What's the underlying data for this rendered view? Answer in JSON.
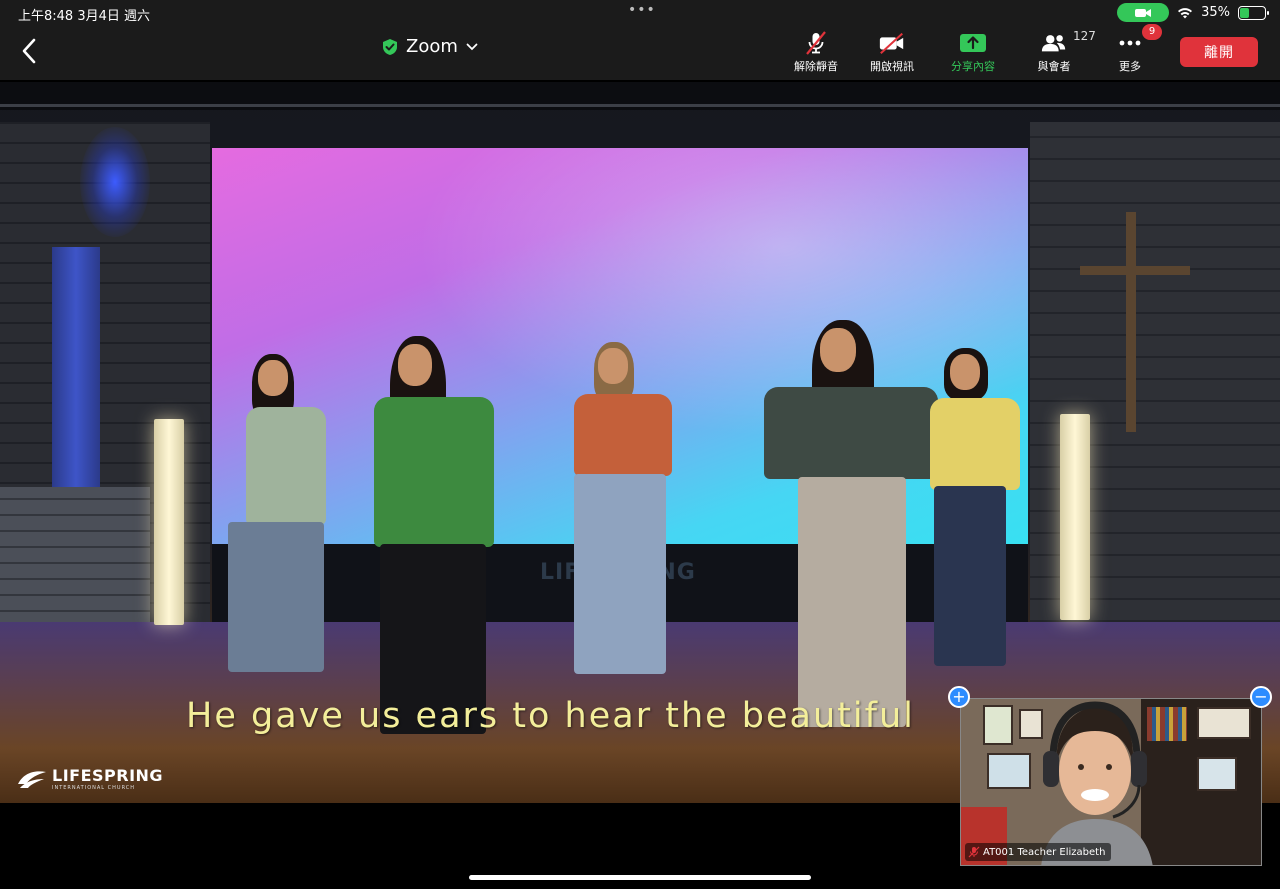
{
  "status_bar": {
    "time_date": "上午8:48   3月4日 週六",
    "dots": "•••",
    "battery_percent": "35%",
    "battery_level": 0.35,
    "colors": {
      "camera_pill": "#34c759",
      "battery_fill": "#34c759"
    }
  },
  "toolbar": {
    "meeting_title": "Zoom",
    "buttons": {
      "unmute": "解除靜音",
      "start_video": "開啟視訊",
      "share": "分享內容",
      "participants": "與會者",
      "more": "更多"
    },
    "participant_count": "127",
    "more_badge": "9",
    "leave_label": "離開",
    "colors": {
      "share_green": "#34c759",
      "leave_red": "#e0333b",
      "badge_red": "#e0333b",
      "shield_green": "#34c759"
    }
  },
  "main_video": {
    "lyrics_caption": "He gave us ears to hear the beautiful",
    "church_logo": {
      "name": "LIFESPRING",
      "subtitle": "INTERNATIONAL CHURCH"
    },
    "stage_logo": "LIFESPRING"
  },
  "pip": {
    "participant_name": "AT001 Teacher Elizabeth",
    "expand_symbol": "+",
    "collapse_symbol": "−",
    "muted": true,
    "colors": {
      "control_blue": "#2d8cff",
      "mic_muted": "#e0333b"
    }
  }
}
